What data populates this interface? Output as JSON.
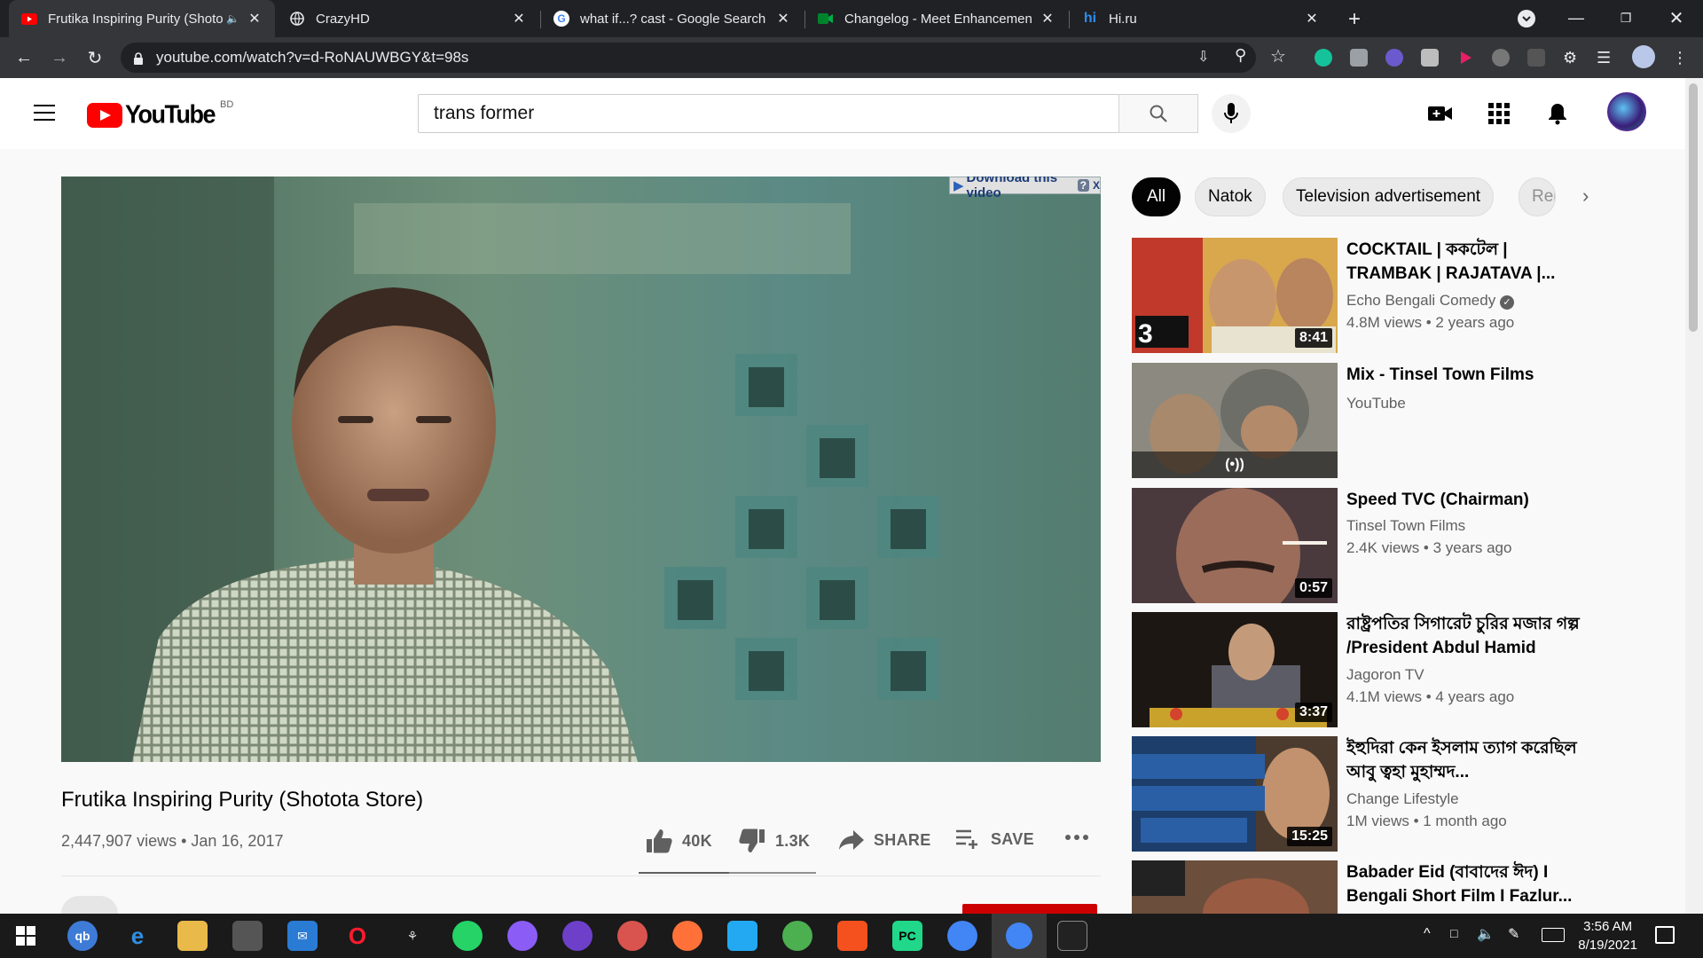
{
  "browser": {
    "tabs": [
      {
        "title": "Frutika Inspiring Purity (Shoto",
        "favicon": "youtube-icon",
        "active": true,
        "audio": true
      },
      {
        "title": "CrazyHD",
        "favicon": "globe-icon"
      },
      {
        "title": "what if...? cast - Google Search",
        "favicon": "google-icon"
      },
      {
        "title": "Changelog - Meet Enhancement",
        "favicon": "meet-icon"
      },
      {
        "title": "Hi.ru",
        "favicon": "hi-icon"
      }
    ],
    "url": "youtube.com/watch?v=d-RoNAUWBGY&t=98s"
  },
  "youtube": {
    "logo_text": "YouTube",
    "country_code": "BD",
    "search_value": "trans former",
    "download_label": "Download this video",
    "download_help": "?",
    "download_close": "X"
  },
  "video": {
    "title": "Frutika Inspiring Purity (Shotota Store)",
    "meta": "2,447,907 views • Jan 16, 2017",
    "likes": "40K",
    "dislikes": "1.3K",
    "share_label": "SHARE",
    "save_label": "SAVE",
    "like_ratio": 0.51
  },
  "chips": [
    "All",
    "Natok",
    "Television advertisement",
    "Rel"
  ],
  "recommendations": [
    {
      "title": "COCKTAIL | ককটেল | TRAMBAK | RAJATAVA |...",
      "channel": "Echo Bengali Comedy",
      "verified": true,
      "views": "4.8M views • 2 years ago",
      "duration": "8:41"
    },
    {
      "title": "Mix - Tinsel Town Films",
      "channel": "YouTube",
      "views": "",
      "duration": "",
      "live_icon": true
    },
    {
      "title": "Speed TVC (Chairman)",
      "channel": "Tinsel Town Films",
      "views": "2.4K views • 3 years ago",
      "duration": "0:57"
    },
    {
      "title": "রাষ্ট্রপতির সিগারেট চুরির মজার গল্প /President Abdul Hamid",
      "channel": "Jagoron TV",
      "views": "4.1M views • 4 years ago",
      "duration": "3:37"
    },
    {
      "title": "ইহুদিরা কেন ইসলাম ত্যাগ করেছিল আবু ত্বহা মুহাম্মদ...",
      "channel": "Change Lifestyle",
      "views": "1M views • 1 month ago",
      "duration": "15:25"
    },
    {
      "title": "Babader Eid (বাবাদের ঈদ) I Bengali Short Film I Fazlur...",
      "channel": "",
      "views": "",
      "duration": ""
    }
  ],
  "taskbar": {
    "time": "3:56 AM",
    "date": "8/19/2021"
  }
}
